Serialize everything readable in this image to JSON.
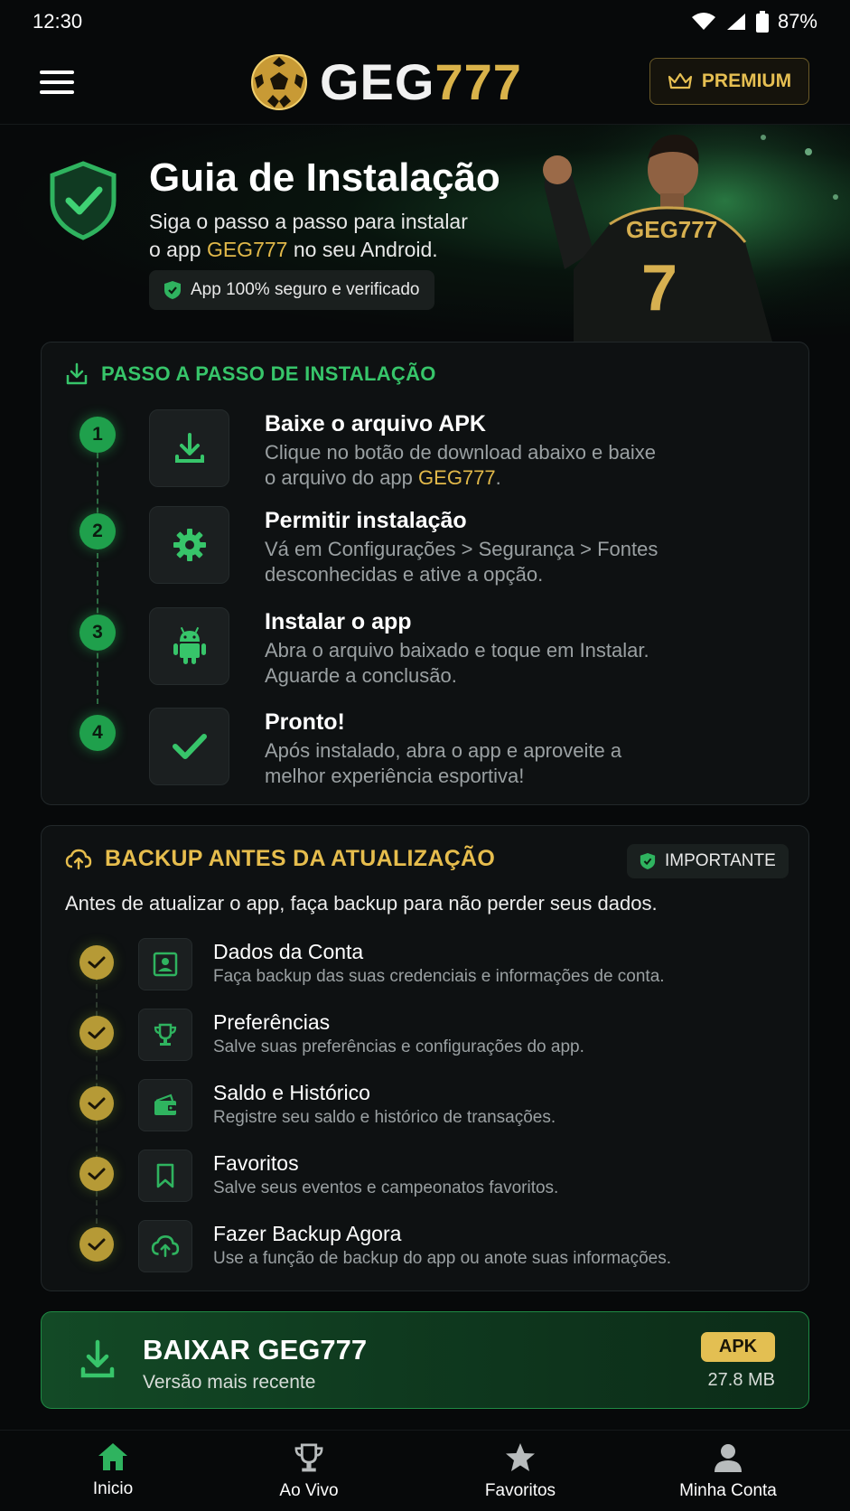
{
  "status_bar": {
    "time": "12:30",
    "battery": "87%"
  },
  "header": {
    "logo_text_a": "GEG",
    "logo_text_b": "777",
    "premium_label": "PREMIUM"
  },
  "hero": {
    "title": "Guia de Instalação",
    "sub_line1": "Siga o passo a passo para instalar",
    "sub_line2_a": "o app ",
    "sub_line2_brand": "GEG777",
    "sub_line2_b": " no seu Android.",
    "safe_chip": "App 100% seguro e verificado",
    "jersey_name": "GEG777",
    "jersey_number": "7"
  },
  "steps_card": {
    "title": "PASSO A PASSO DE INSTALAÇÃO",
    "steps": [
      {
        "num": "1",
        "title": "Baixe o arquivo APK",
        "desc_a": "Clique no botão de download abaixo e baixe o arquivo do app ",
        "desc_brand": "GEG777",
        "desc_b": ".",
        "icon": "download-icon"
      },
      {
        "num": "2",
        "title": "Permitir instalação",
        "desc": "Vá em Configurações > Segurança > Fontes desconhecidas e ative a opção.",
        "icon": "gear-icon"
      },
      {
        "num": "3",
        "title": "Instalar o app",
        "desc": "Abra o arquivo baixado e toque em Instalar. Aguarde a conclusão.",
        "icon": "android-icon"
      },
      {
        "num": "4",
        "title": "Pronto!",
        "desc": "Após instalado, abra o app e aproveite a melhor experiência esportiva!",
        "icon": "check-icon"
      }
    ]
  },
  "backup_card": {
    "title": "BACKUP ANTES DA ATUALIZAÇÃO",
    "badge": "IMPORTANTE",
    "intro": "Antes de atualizar o app, faça backup para não perder seus dados.",
    "items": [
      {
        "title": "Dados da Conta",
        "desc": "Faça backup das suas credenciais e informações de conta.",
        "icon": "account-icon"
      },
      {
        "title": "Preferências",
        "desc": "Salve suas preferências e configurações do app.",
        "icon": "trophy-icon"
      },
      {
        "title": "Saldo e Histórico",
        "desc": "Registre seu saldo e histórico de transações.",
        "icon": "wallet-icon"
      },
      {
        "title": "Favoritos",
        "desc": "Salve seus eventos e campeonatos favoritos.",
        "icon": "bookmark-icon"
      },
      {
        "title": "Fazer Backup Agora",
        "desc": "Use a função de backup do app ou anote suas informações.",
        "icon": "cloud-upload-icon"
      }
    ]
  },
  "download": {
    "title": "BAIXAR GEG777",
    "subtitle": "Versão mais recente",
    "badge": "APK",
    "size": "27.8 MB"
  },
  "bottom_nav": [
    {
      "label": "Inicio",
      "icon": "home-icon",
      "active": true
    },
    {
      "label": "Ao Vivo",
      "icon": "trophy-icon"
    },
    {
      "label": "Favoritos",
      "icon": "star-icon"
    },
    {
      "label": "Minha Conta",
      "icon": "user-icon"
    }
  ],
  "colors": {
    "green": "#37c56a",
    "gold": "#e2b94a",
    "background": "#07090a"
  }
}
